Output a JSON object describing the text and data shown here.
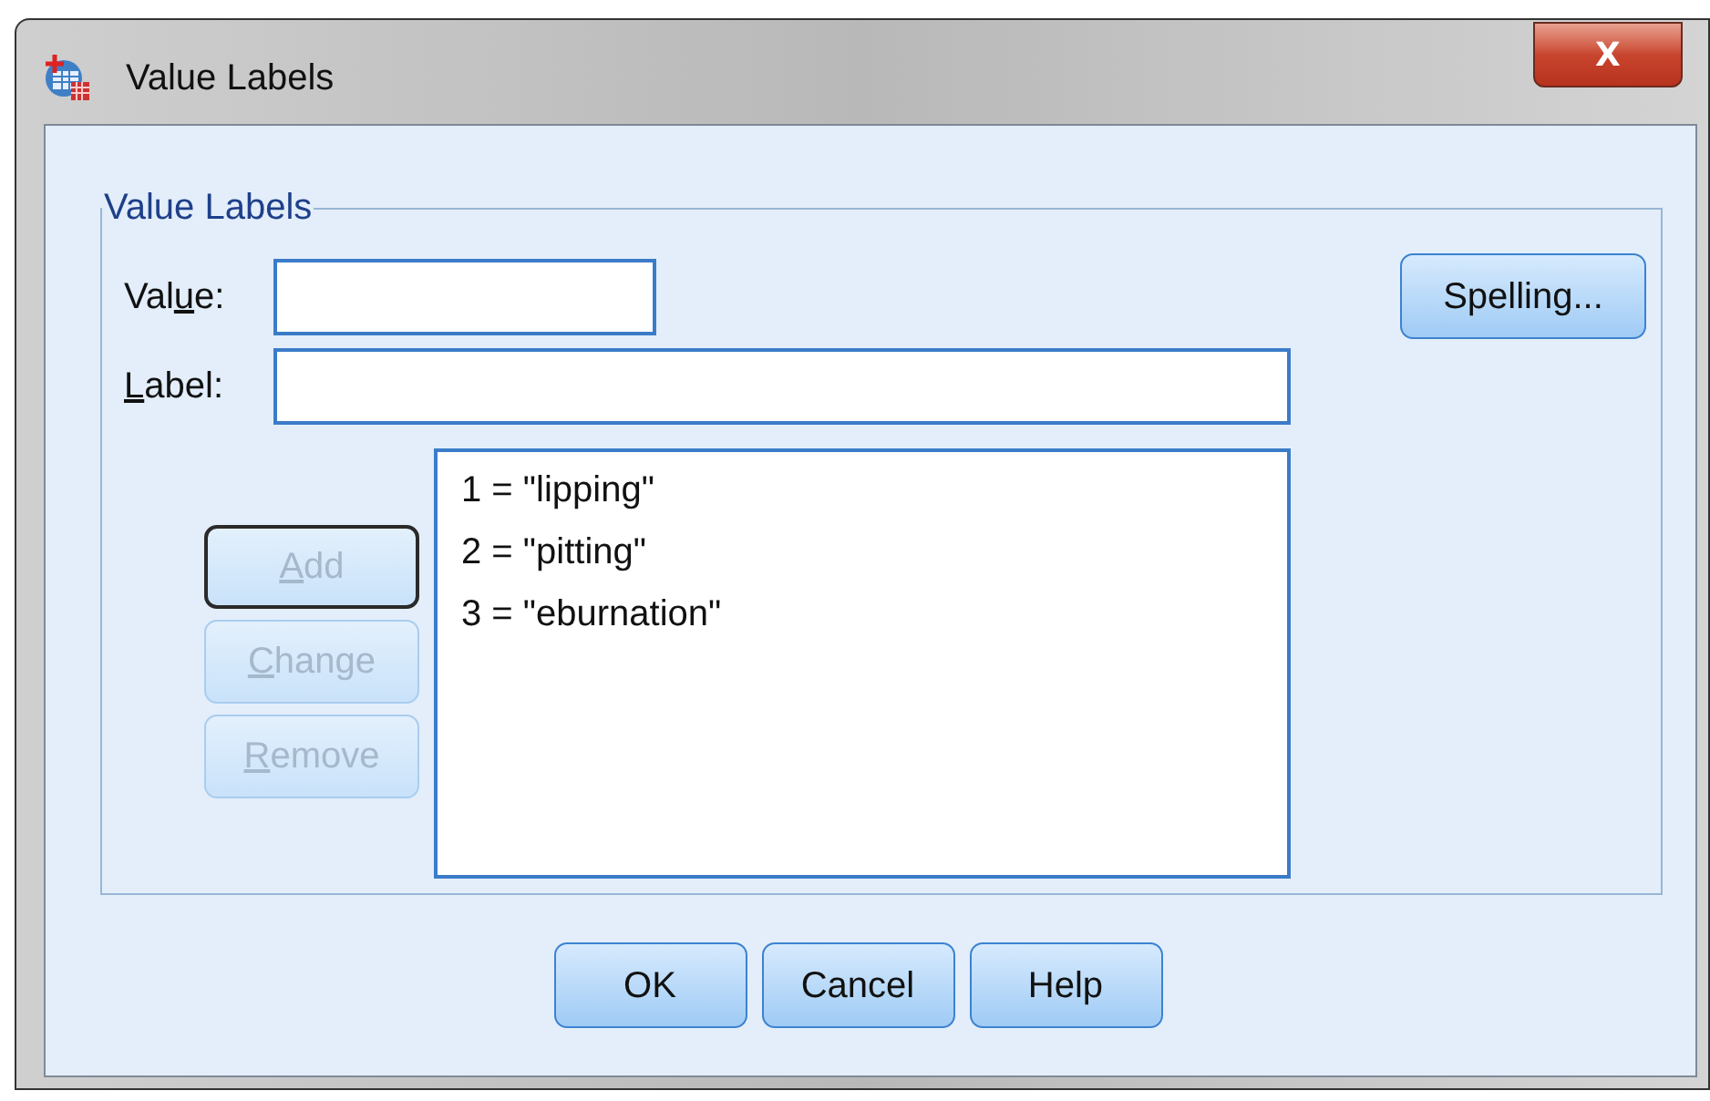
{
  "window": {
    "title": "Value Labels",
    "close_label": "X"
  },
  "group": {
    "title": "Value Labels"
  },
  "value_field": {
    "label": {
      "pre": "Val",
      "key": "u",
      "post": "e:"
    }
  },
  "label_field": {
    "label": {
      "key": "L",
      "post": "abel:"
    }
  },
  "spelling_button": {
    "label": "Spelling...",
    "disabled": false
  },
  "side_buttons": [
    {
      "label": {
        "key": "A",
        "post": "dd"
      },
      "disabled": true,
      "default": true
    },
    {
      "label": {
        "key": "C",
        "post": "hange"
      },
      "disabled": true,
      "default": false
    },
    {
      "label": {
        "key": "R",
        "post": "emove"
      },
      "disabled": true,
      "default": false
    }
  ],
  "value_list": [
    {
      "text": "1 = \"lipping\"",
      "selected": false
    },
    {
      "text": "2 = \"pitting\"",
      "selected": false
    },
    {
      "text": "3 = \"eburnation\"",
      "selected": false
    }
  ],
  "buttons": [
    {
      "label": "OK",
      "disabled": false
    },
    {
      "label": "Cancel",
      "disabled": false
    },
    {
      "label": "Help",
      "disabled": false
    }
  ]
}
